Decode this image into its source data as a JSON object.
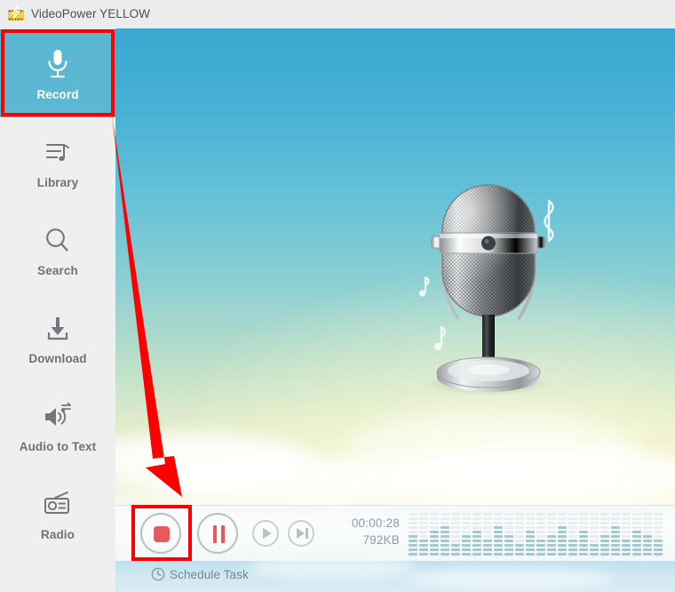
{
  "window": {
    "title": "VideoPower YELLOW",
    "app_icon": "film-lightning-icon"
  },
  "sidebar": {
    "items": [
      {
        "label": "Record",
        "icon": "microphone-icon",
        "active": true
      },
      {
        "label": "Library",
        "icon": "music-list-icon",
        "active": false
      },
      {
        "label": "Search",
        "icon": "search-icon",
        "active": false
      },
      {
        "label": "Download",
        "icon": "download-icon",
        "active": false
      },
      {
        "label": "Audio to Text",
        "icon": "speaker-text-icon",
        "active": false
      },
      {
        "label": "Radio",
        "icon": "radio-icon",
        "active": false
      }
    ]
  },
  "stage": {
    "artwork": "vintage-microphone-illustration",
    "music_notes": "floating-music-notes"
  },
  "controls": {
    "stop": {
      "label": "Stop",
      "icon": "stop-icon",
      "enabled": true
    },
    "pause": {
      "label": "Pause",
      "icon": "pause-icon",
      "enabled": true
    },
    "play": {
      "label": "Play",
      "icon": "play-icon",
      "enabled": false
    },
    "next": {
      "label": "Next",
      "icon": "next-track-icon",
      "enabled": false
    },
    "elapsed_time": "00:00:28",
    "file_size": "792KB",
    "visualizer": {
      "name": "audio-level-visualizer",
      "columns": 24,
      "segments_per_column": 10,
      "levels": [
        5,
        4,
        6,
        7,
        3,
        5,
        6,
        4,
        7,
        5,
        3,
        6,
        4,
        5,
        7,
        4,
        6,
        3,
        5,
        7,
        4,
        6,
        5,
        4
      ],
      "active_color": "#a2c8d2",
      "inactive_color": "#e9edef"
    }
  },
  "schedule": {
    "label": "Schedule Task",
    "icon": "clock-icon"
  },
  "annotations": {
    "highlight_color": "#fe0000",
    "record_highlight": "red-box-around-record",
    "stop_highlight": "red-box-around-stop-button",
    "arrow": "red-arrow-record-to-stop"
  },
  "colors": {
    "accent": "#5cb7d3",
    "sidebar_bg": "#efefef",
    "titlebar_bg": "#ececec",
    "record_red": "#e8595b"
  }
}
